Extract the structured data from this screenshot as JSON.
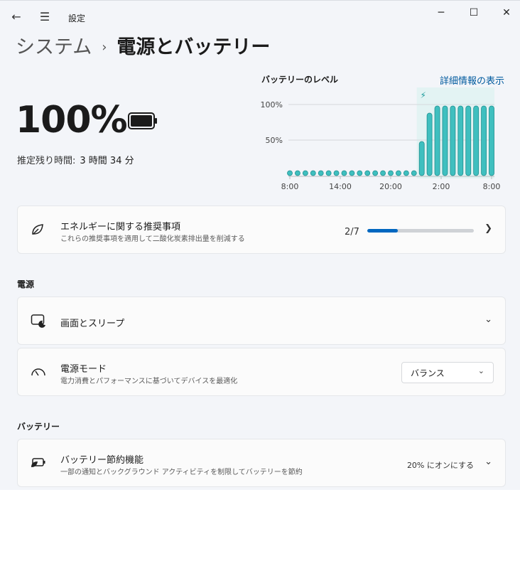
{
  "window": {
    "title": "設定",
    "back_icon": "←",
    "menu_icon": "☰",
    "minimize_icon": "─",
    "maximize_icon": "☐",
    "close_icon": "✕"
  },
  "breadcrumb": {
    "root": "システム",
    "separator": "›",
    "current": "電源とバッテリー"
  },
  "battery": {
    "percent": "100%",
    "remaining_label": "推定残り時間:",
    "remaining_value": "3 時間 34 分"
  },
  "level": {
    "title": "バッテリーのレベル",
    "details_link": "詳細情報の表示"
  },
  "chart_data": {
    "type": "bar",
    "title": "バッテリーのレベル",
    "y_ticks": [
      "100%",
      "50%"
    ],
    "x_ticks": [
      "8:00",
      "14:00",
      "20:00",
      "2:00",
      "8:00"
    ],
    "ylim": [
      0,
      100
    ],
    "values": [
      3,
      3,
      3,
      3,
      3,
      3,
      3,
      3,
      3,
      3,
      3,
      3,
      3,
      3,
      3,
      3,
      3,
      48,
      88,
      98,
      98,
      98,
      98,
      98,
      98,
      98,
      98
    ],
    "charging_from_index": 17,
    "bar_color": "#3fbfbf",
    "charging_band_color": "#e3f3f3"
  },
  "energy": {
    "title": "エネルギーに関する推奨事項",
    "subtitle": "これらの推奨事項を適用して二酸化炭素排出量を削減する",
    "progress_label": "2/7",
    "progress_fraction": 0.2857,
    "icon": "leaf-icon"
  },
  "power_section": {
    "heading": "電源",
    "screen_sleep": {
      "title": "画面とスリープ",
      "icon": "screen-sleep-icon"
    },
    "power_mode": {
      "title": "電源モード",
      "subtitle": "電力消費とパフォーマンスに基づいてデバイスを最適化",
      "selected": "バランス",
      "icon": "gauge-icon"
    }
  },
  "battery_section": {
    "heading": "バッテリー",
    "saver": {
      "title": "バッテリー節約機能",
      "subtitle": "一部の通知とバックグラウンド アクティビティを制限してバッテリーを節約",
      "status": "20% にオンにする",
      "icon": "battery-saver-icon"
    }
  },
  "colors": {
    "accent": "#0067c0",
    "link": "#005a9e",
    "chart": "#3fbfbf"
  }
}
